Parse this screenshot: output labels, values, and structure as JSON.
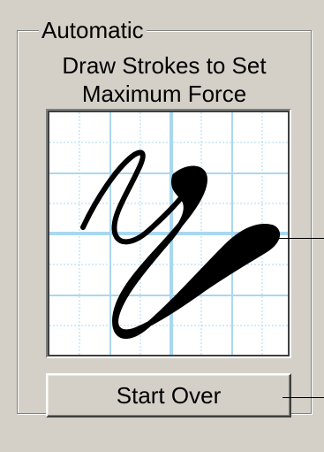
{
  "group": {
    "title": "Automatic"
  },
  "instructions": {
    "line1": "Draw Strokes to Set",
    "line2": "Maximum Force"
  },
  "buttons": {
    "start_over": "Start Over"
  },
  "colors": {
    "dialog_bg": "#d4d0c8",
    "grid_major": "#a8d8f0",
    "grid_minor": "#a8d8f0",
    "canvas_bg": "#ffffff",
    "stroke": "#000000"
  },
  "icons": {
    "canvas_callout": "leader-line",
    "button_callout": "leader-line"
  }
}
